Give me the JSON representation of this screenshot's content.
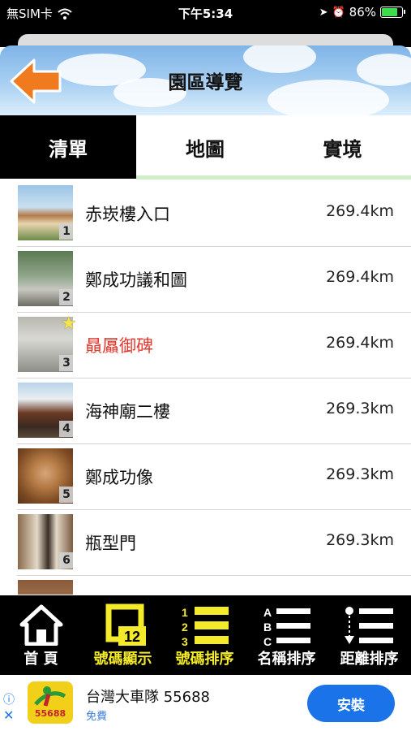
{
  "status_bar": {
    "carrier": "無SIM卡",
    "time": "下午5:34",
    "battery": "86%",
    "battery_level": 0.86
  },
  "header": {
    "title": "園區導覽"
  },
  "tabs": [
    {
      "label": "清單",
      "active": true
    },
    {
      "label": "地圖",
      "active": false
    },
    {
      "label": "實境",
      "active": false
    }
  ],
  "items": [
    {
      "number": "1",
      "name": "赤崁樓入口",
      "distance": "269.4km",
      "highlighted": false,
      "starred": false
    },
    {
      "number": "2",
      "name": "鄭成功議和圖",
      "distance": "269.4km",
      "highlighted": false,
      "starred": false
    },
    {
      "number": "3",
      "name": "贔屭御碑",
      "distance": "269.4km",
      "highlighted": true,
      "starred": true
    },
    {
      "number": "4",
      "name": "海神廟二樓",
      "distance": "269.3km",
      "highlighted": false,
      "starred": false
    },
    {
      "number": "5",
      "name": "鄭成功像",
      "distance": "269.3km",
      "highlighted": false,
      "starred": false
    },
    {
      "number": "6",
      "name": "瓶型門",
      "distance": "269.3km",
      "highlighted": false,
      "starred": false
    }
  ],
  "toolbar": {
    "home": "首 頁",
    "show_number": "號碼顯示",
    "show_number_badge": "12",
    "sort_number": "號碼排序",
    "sort_name": "名稱排序",
    "sort_distance": "距離排序",
    "sort_number_glyphs": [
      "1",
      "2",
      "3"
    ],
    "sort_name_glyphs": [
      "A",
      "B",
      "C"
    ]
  },
  "ad": {
    "app_name": "台灣大車隊 55688",
    "price": "免費",
    "install": "安裝",
    "logo_text": "55688"
  },
  "colors": {
    "accent_yellow": "#f3ea2a",
    "highlight_red": "#e23a2f",
    "install_blue": "#1a73e8"
  }
}
